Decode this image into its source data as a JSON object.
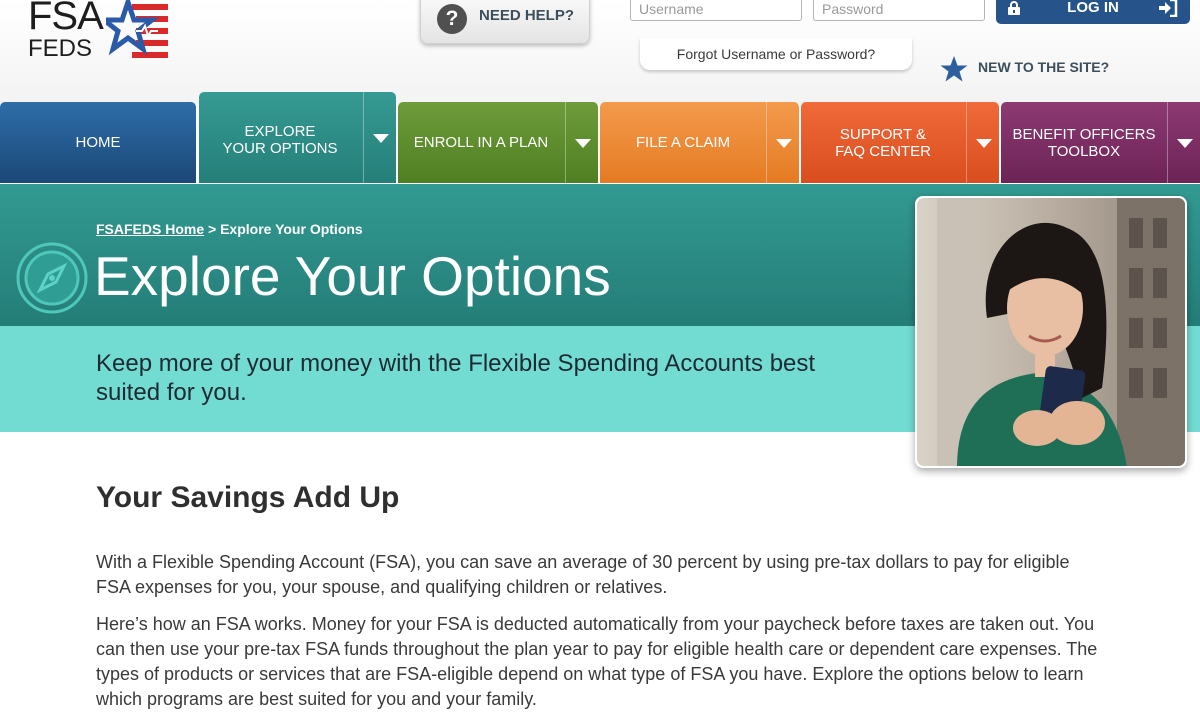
{
  "logo": {
    "line1": "FSA",
    "line2": "FEDS"
  },
  "header": {
    "help_label": "NEED HELP?",
    "username_placeholder": "Username",
    "password_placeholder": "Password",
    "login_label": "LOG IN",
    "forgot_link": "Forgot Username or Password?",
    "new_site": "NEW TO THE SITE?"
  },
  "nav": {
    "home": "HOME",
    "explore_line1": "EXPLORE",
    "explore_line2": "YOUR OPTIONS",
    "enroll": "ENROLL IN A PLAN",
    "claim": "FILE A CLAIM",
    "support_line1": "SUPPORT &",
    "support_line2": "FAQ CENTER",
    "toolbox_line1": "BENEFIT OFFICERS",
    "toolbox_line2": "TOOLBOX"
  },
  "hero": {
    "breadcrumb_home": "FSAFEDS Home",
    "breadcrumb_sep": " > ",
    "breadcrumb_current": "Explore Your Options",
    "title": "Explore Your Options",
    "tagline": "Keep more of your money with the Flexible Spending Accounts best suited for you."
  },
  "content": {
    "heading": "Your Savings Add Up",
    "para1": "With a Flexible Spending Account (FSA), you can save an average of 30 percent by using pre-tax dollars to pay for eligible FSA expenses for you, your spouse, and qualifying children or relatives.",
    "para2": "Here’s how an FSA works. Money for your FSA is deducted automatically from your paycheck before taxes are taken out. You can then use your pre-tax FSA funds throughout the plan year to pay for eligible health care or dependent care expenses. The types of products or services that are FSA-eligible depend on what type of FSA you have. Explore the options below to learn which programs are best suited for you and your family."
  },
  "colors": {
    "home": "#1b4877",
    "explore": "#2b8a84",
    "enroll": "#5a8a2c",
    "claim": "#ee8a3a",
    "support": "#e25a2a",
    "toolbox": "#7a2d63",
    "hero_band": "#72dcd3",
    "login": "#25538a"
  },
  "icons": {
    "help": "question-circle-icon",
    "login": "lock-icon",
    "enter": "sign-in-icon",
    "new_site": "star-icon",
    "hero": "compass-icon"
  }
}
